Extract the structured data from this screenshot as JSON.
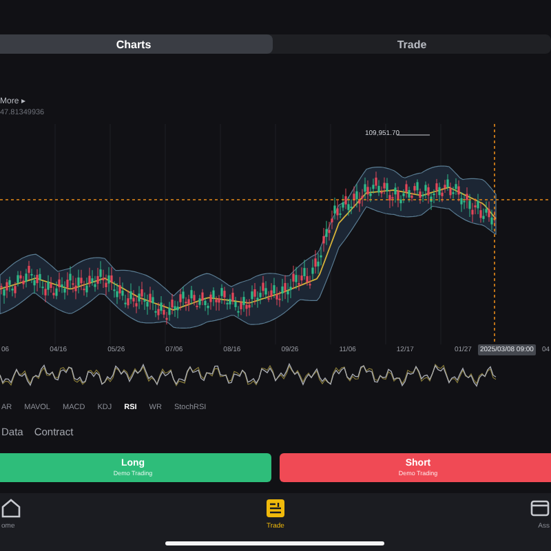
{
  "view_tabs": [
    {
      "label": "Charts",
      "selected": true
    },
    {
      "label": "Trade",
      "selected": false
    }
  ],
  "chart_header": {
    "more": "More ▸",
    "reading": "47.81349936"
  },
  "price_chart": {
    "high_label": "109,951.70",
    "crosshair_time": "2025/03/08 09:00",
    "x_labels": [
      "06",
      "04/16",
      "05/26",
      "07/06",
      "08/16",
      "09/26",
      "11/06",
      "12/17",
      "01/27",
      "04"
    ]
  },
  "indicators": [
    {
      "label": "AR",
      "selected": false
    },
    {
      "label": "MAVOL",
      "selected": false
    },
    {
      "label": "MACD",
      "selected": false
    },
    {
      "label": "KDJ",
      "selected": false
    },
    {
      "label": "RSI",
      "selected": true
    },
    {
      "label": "WR",
      "selected": false
    },
    {
      "label": "StochRSI",
      "selected": false
    }
  ],
  "info_tabs": [
    {
      "label": "Data"
    },
    {
      "label": "Contract"
    }
  ],
  "actions": [
    {
      "kind": "long",
      "label": "Long",
      "sublabel": "Demo Trading"
    },
    {
      "kind": "short",
      "label": "Short",
      "sublabel": "Demo Trading"
    }
  ],
  "nav": [
    {
      "kind": "home",
      "label": "ome",
      "selected": false
    },
    {
      "kind": "trade",
      "label": "Trade",
      "selected": true
    },
    {
      "kind": "assets",
      "label": "Ass",
      "selected": false
    }
  ]
}
